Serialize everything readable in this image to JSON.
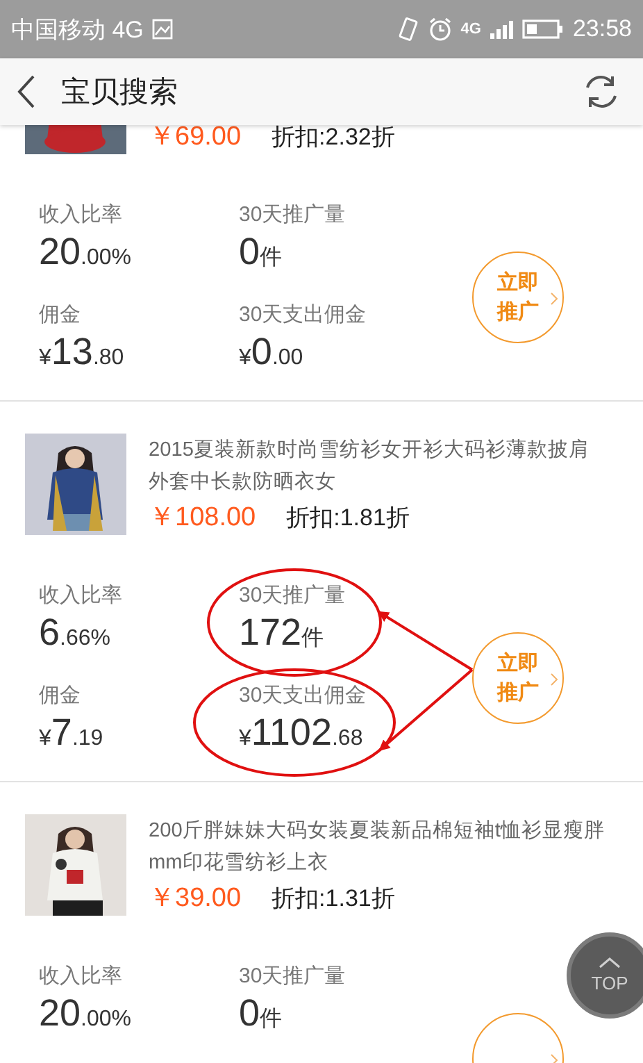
{
  "status_bar": {
    "carrier": "中国移动 4G",
    "network": "4G",
    "time": "23:58"
  },
  "header": {
    "title": "宝贝搜索"
  },
  "items": [
    {
      "partial": true,
      "thumbnail": {
        "kind": "picture"
      },
      "price": "￥69.00",
      "discount": "折扣:2.32折",
      "stats": [
        {
          "label": "收入比率",
          "value": "20.00%"
        },
        {
          "label": "30天推广量",
          "value": "0件"
        },
        {
          "label": "佣金",
          "value": "¥13.80"
        },
        {
          "label": "30天支出佣金",
          "value": "¥0.00"
        }
      ],
      "button": {
        "lines": [
          "立即",
          "推广"
        ]
      }
    },
    {
      "partial": false,
      "thumbnail": {
        "kind": "picture"
      },
      "title": "2015夏装新款时尚雪纺衫女开衫大码衫薄款披肩外套中长款防晒衣女",
      "price": "￥108.00",
      "discount": "折扣:1.81折",
      "stats": [
        {
          "label": "收入比率",
          "value": "6.66%",
          "circled": false
        },
        {
          "label": "30天推广量",
          "value": "172件",
          "circled": true
        },
        {
          "label": "佣金",
          "value": "¥7.19",
          "circled": false
        },
        {
          "label": "30天支出佣金",
          "value": "¥1102.68",
          "circled": true
        }
      ],
      "button": {
        "lines": [
          "立即",
          "推广"
        ]
      }
    },
    {
      "partial": false,
      "thumbnail": {
        "kind": "picture"
      },
      "title": "200斤胖妹妹大码女装夏装新品棉短袖t恤衫显瘦胖mm印花雪纺衫上衣",
      "price": "￥39.00",
      "discount": "折扣:1.31折",
      "stats": [
        {
          "label": "收入比率",
          "value": "20.00%"
        },
        {
          "label": "30天推广量",
          "value": "0件"
        }
      ],
      "button": {
        "kind": "promote"
      }
    }
  ],
  "top_button": {
    "label": "TOP"
  }
}
